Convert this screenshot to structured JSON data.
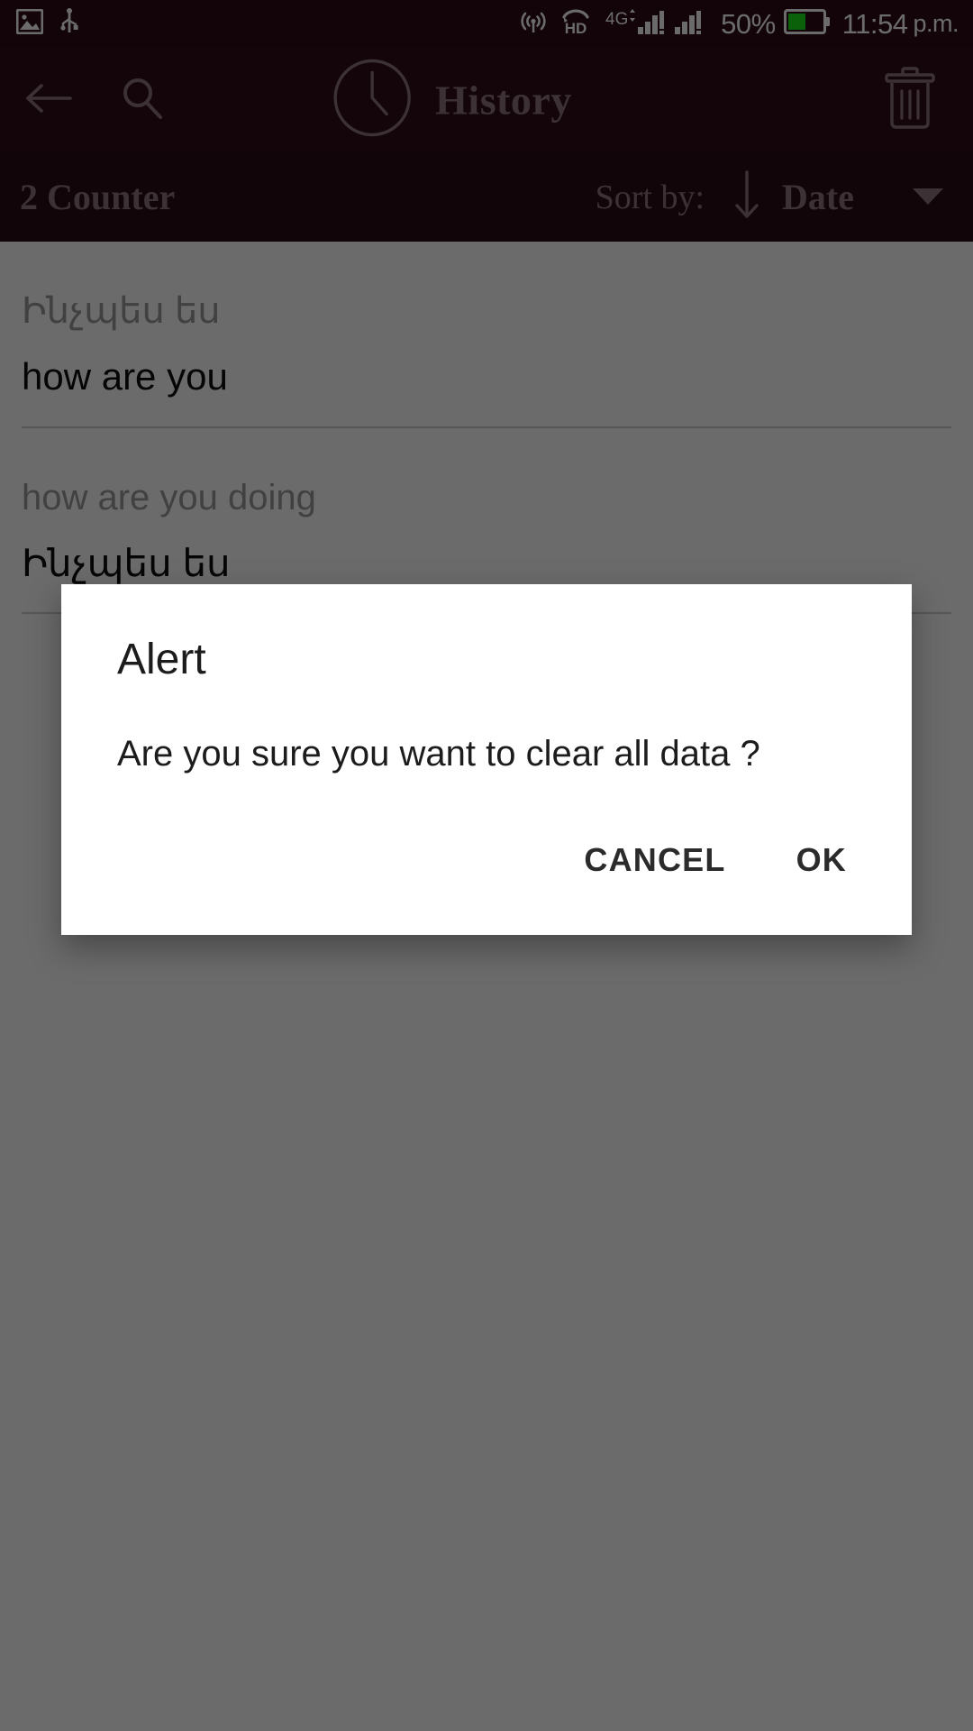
{
  "status_bar": {
    "left_icons": [
      "image-icon",
      "usb-icon"
    ],
    "right_icons": [
      "hotspot-icon",
      "hd-call-icon",
      "4g-signal-icon",
      "signal-bars-icon"
    ],
    "battery_percent": "50%",
    "battery_level": 50,
    "time": "11:54",
    "ampm": "p.m.",
    "background_color": "#2d0a14"
  },
  "app_bar": {
    "back_label": "back-arrow",
    "search_label": "search",
    "clock_label": "clock",
    "title": "History",
    "delete_label": "delete-all",
    "background_color": "#300d1a",
    "foreground_color": "#8f755c"
  },
  "sort_bar": {
    "counter": "2 Counter",
    "sort_by_label": "Sort by:",
    "sort_direction": "descending",
    "sort_field": "Date",
    "dropdown_caret": "caret-down"
  },
  "history": {
    "items": [
      {
        "source": "Ինչպես ես",
        "target": "how are you"
      },
      {
        "source": "how are you doing",
        "target": "Ինչպես ես"
      }
    ]
  },
  "dialog": {
    "title": "Alert",
    "message": "Are you sure you want to clear all data ?",
    "cancel_label": "CANCEL",
    "ok_label": "OK"
  }
}
